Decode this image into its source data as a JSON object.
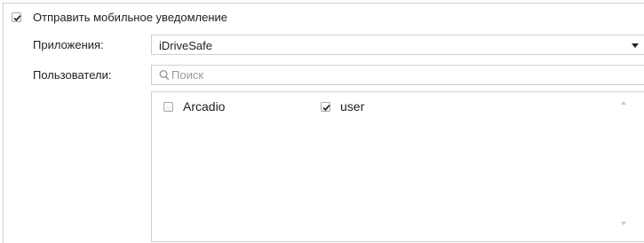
{
  "notification": {
    "label": "Отправить мобильное уведомление",
    "checked": true
  },
  "applications": {
    "label": "Приложения:",
    "selected": "iDriveSafe"
  },
  "users": {
    "label": "Пользователи:",
    "search_placeholder": "Поиск",
    "search_value": "",
    "items": [
      {
        "label": "Arcadio",
        "checked": false
      },
      {
        "label": "user",
        "checked": true
      }
    ]
  },
  "icons": {
    "checkbox_checked": "checkmark-icon",
    "dropdown": "chevron-down-icon",
    "search": "search-icon",
    "scroll_up": "scroll-up-icon",
    "scroll_down": "scroll-down-icon"
  }
}
